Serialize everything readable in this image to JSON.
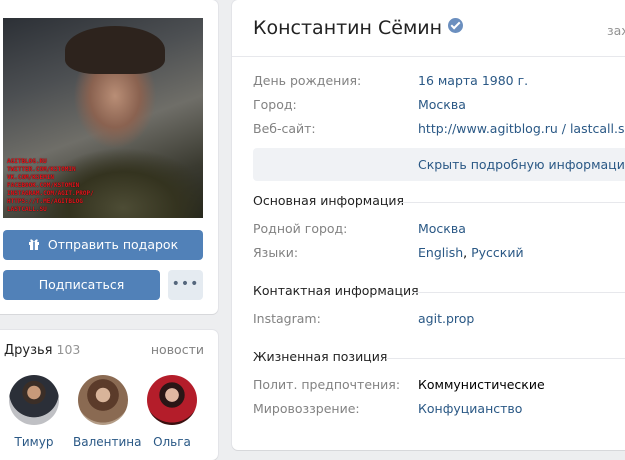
{
  "left": {
    "photo_watermark": [
      "AGITBLOG.RU",
      "TWITTER.COM/KSTOMIN",
      "VK.COM/KSEMIN",
      "FACEBOOK.COM/KSTOMIN",
      "INSTAGRAM.COM/AGIT.PROP/",
      "HTTPS://T.ME/AGITBLOG",
      "LASTCALL.SU"
    ],
    "gift_button": "Отправить подарок",
    "gift_icon": "gift-icon",
    "subscribe_button": "Подписаться",
    "more_button": "•••"
  },
  "friends": {
    "title": "Друзья",
    "count": "103",
    "news_link": "новости",
    "items": [
      {
        "name": "Тимур"
      },
      {
        "name": "Валентина"
      },
      {
        "name": "Ольга"
      }
    ]
  },
  "profile": {
    "name": "Константин Сёмин",
    "verified_icon": "verified-check-icon",
    "status_link": "зах",
    "birthday_label": "День рождения:",
    "birthday_value": "16 марта 1980 г.",
    "city_label": "Город:",
    "city_value": "Москва",
    "site_label": "Веб-сайт:",
    "site_value": "http://www.agitblog.ru / lastcall.su",
    "details_link": "Скрыть подробную информацию",
    "section_main": "Основная информация",
    "hometown_label": "Родной город:",
    "hometown_value": "Москва",
    "languages_label": "Языки:",
    "language_1": "English",
    "language_sep": ",",
    "language_2": "Русский",
    "section_contact": "Контактная информация",
    "instagram_label": "Instagram:",
    "instagram_value": "agit.prop",
    "section_life": "Жизненная позиция",
    "political_label": "Полит. предпочтения:",
    "political_value": "Коммунистические",
    "worldview_label": "Мировоззрение:",
    "worldview_value": "Конфуцианство"
  },
  "colors": {
    "link": "#2a5885",
    "button": "#5181b8",
    "background": "#edeef0",
    "watermark": "#e8141b"
  }
}
